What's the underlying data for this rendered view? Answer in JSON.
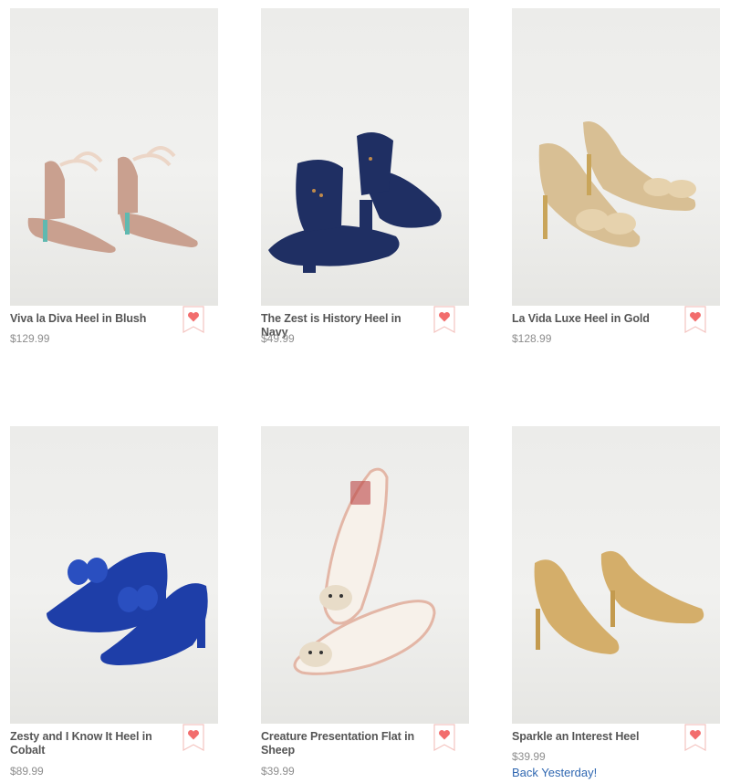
{
  "products": [
    {
      "name": "Viva la Diva Heel in Blush",
      "price": "$129.99",
      "fav_icon": "heart-icon"
    },
    {
      "name": "The Zest is History Heel in Navy",
      "price": "$49.99",
      "fav_icon": "heart-icon"
    },
    {
      "name": "La Vida Luxe Heel in Gold",
      "price": "$128.99",
      "fav_icon": "heart-icon"
    },
    {
      "name": "Zesty and I Know It Heel in Cobalt",
      "price": "$89.99",
      "fav_icon": "heart-icon"
    },
    {
      "name": "Creature Presentation Flat in Sheep",
      "price": "$39.99",
      "fav_icon": "heart-icon"
    },
    {
      "name": "Sparkle an Interest Heel",
      "price": "$39.99",
      "extra": "Back Yesterday!",
      "fav_icon": "heart-icon"
    }
  ],
  "colors": {
    "heart": "#f26d6d",
    "ribbon_border": "#f4c4c0",
    "name_text": "#555555",
    "price_text": "#8d8d8d",
    "link_blue": "#2f67b1"
  }
}
